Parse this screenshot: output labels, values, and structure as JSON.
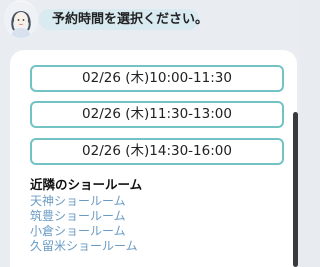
{
  "assistant": {
    "message": "予約時間を選択ください。"
  },
  "time_slots": [
    {
      "label": "02/26 (木)10:00-11:30"
    },
    {
      "label": "02/26 (木)11:30-13:00"
    },
    {
      "label": "02/26 (木)14:30-16:00"
    }
  ],
  "showrooms": {
    "title": "近隣のショールーム",
    "items": [
      {
        "label": "天神ショールーム"
      },
      {
        "label": "筑豊ショールーム"
      },
      {
        "label": "小倉ショールーム"
      },
      {
        "label": "久留米ショールーム"
      }
    ]
  },
  "colors": {
    "slot_border": "#73c2c4",
    "link": "#6a9bc4",
    "bubble": "#d9eaf1",
    "background": "#e9edf1"
  },
  "icons": {
    "avatar": "assistant-avatar-icon"
  }
}
